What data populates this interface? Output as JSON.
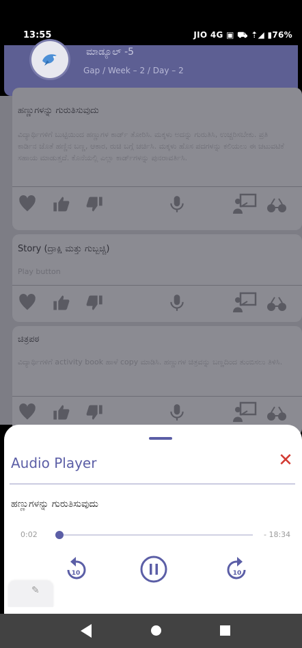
{
  "status_bar": {
    "time": "13:55",
    "right": "JIO 4G ▣ ⛟ ⇡◢ ▮76%"
  },
  "app_bar": {
    "title": "ಮಾಡ್ಯೂಲ್ -5",
    "subtitle": "Gap / Week – 2 / Day – 2"
  },
  "cards": [
    {
      "title": "ಹಣ್ಣುಗಳನ್ನು ಗುರುತಿಸುವುದು",
      "body": "ವಿದ್ಯಾರ್ಥಿಗಳಿಗೆ ಬುಟ್ಟಿಯಿಂದ ಹಣ್ಣುಗಳ ಕಾರ್ಡ್ ತೋರಿಸಿ. ಮಕ್ಕಳು ಅದನ್ನು ಗುರುತಿಸಿ, ಉಚ್ಚರಿಸಬೇಕು. ಪ್ರತಿ ಕಾರ್ಡಿನ ಜೊತೆ ಹಣ್ಣಿನ ಬಣ್ಣ, ಆಕಾರ, ರುಚಿ ಬಗ್ಗೆ ಚರ್ಚಿಸಿ. ಮಕ್ಕಳು ಹೊಸ ಪದಗಳನ್ನು ಕಲಿಯಲು ಈ ಚಟುವಟಿಕೆ ಸಹಾಯ ಮಾಡುತ್ತದೆ. ಕೊನೆಯಲ್ಲಿ ಎಲ್ಲಾ ಕಾರ್ಡ್‌ಗಳನ್ನು ಪುನರಾವರ್ತಿಸಿ."
    },
    {
      "title": "Story (ದ್ರಾಕ್ಷಿ ಮತ್ತು ಗುಬ್ಬಚ್ಚಿ)",
      "body": "Play button"
    },
    {
      "title": "ಚಿತ್ರಪಠ",
      "body": "ವಿದ್ಯಾರ್ಥಿಗಳಿಗೆ activity book ಹಾಳೆ copy ಮಾಡಿಸಿ. ಹಣ್ಣುಗಳ ಚಿತ್ರವನ್ನು ಬಣ್ಣದಿಂದ ತುಂಬಿಸಲು ತಿಳಿಸಿ."
    }
  ],
  "card_actions": [
    "heart-icon",
    "thumbs-up-icon",
    "thumbs-down-icon",
    "microphone-icon",
    "teacher-board-icon",
    "glasses-icon"
  ],
  "player": {
    "title": "Audio Player",
    "close_icon": "close-icon",
    "track_title": "ಹಣ್ಣುಗಳನ್ನು ಗುರುತಿಸುವುದು",
    "current_time": "0:02",
    "total_time": "- 18:34",
    "progress": 0.01,
    "rewind_label": "10",
    "forward_label": "10",
    "accent": "#5b5ea6",
    "close_color": "#d23a32"
  },
  "edit_fab": {
    "icon": "pencil-icon"
  },
  "nav_bar": {
    "back_icon": "back-icon",
    "home_icon": "home-icon",
    "recent_icon": "recents-icon"
  }
}
